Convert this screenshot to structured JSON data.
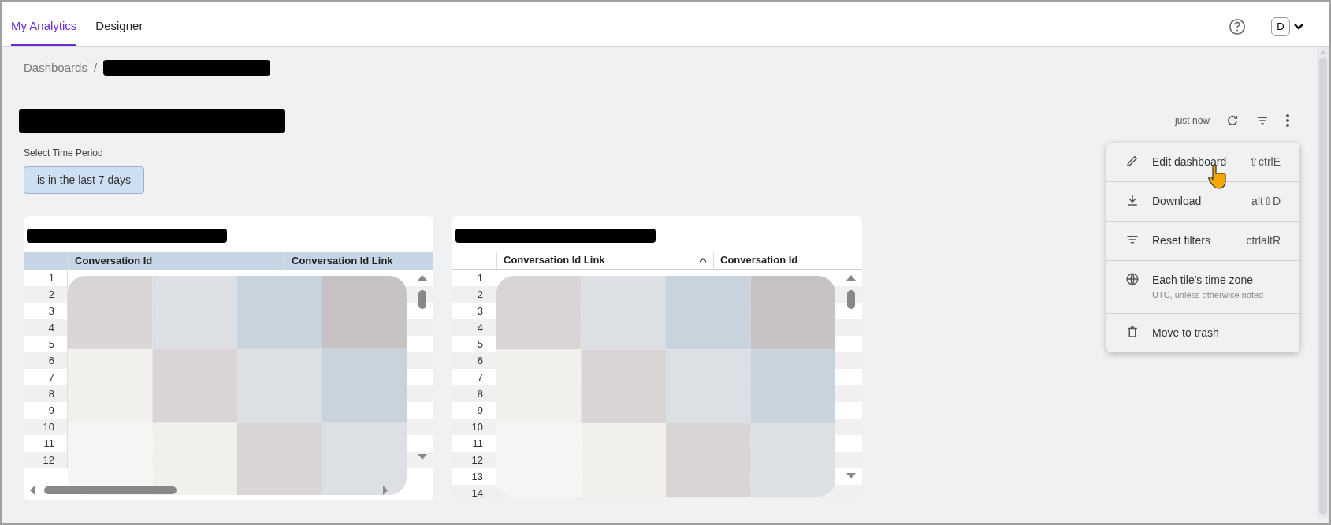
{
  "tabs": [
    {
      "label": "My Analytics",
      "selected": true
    },
    {
      "label": "Designer",
      "selected": false
    }
  ],
  "user": {
    "initial": "D"
  },
  "breadcrumb": {
    "root": "Dashboards",
    "separator": "/"
  },
  "toolbar": {
    "updated": "just now"
  },
  "filter": {
    "label": "Select Time Period",
    "value": "is in the last 7 days"
  },
  "tiles": [
    {
      "kind": "shaded",
      "columns": [
        {
          "label": "Conversation Id",
          "sorted": false
        },
        {
          "label": "Conversation Id Link",
          "sorted": false
        }
      ],
      "rows": [
        "1",
        "2",
        "3",
        "4",
        "5",
        "6",
        "7",
        "8",
        "9",
        "10",
        "11",
        "12"
      ],
      "horizontal_scroll": true
    },
    {
      "kind": "plain",
      "columns": [
        {
          "label": "Conversation Id Link",
          "sorted": true
        },
        {
          "label": "Conversation Id",
          "sorted": false
        }
      ],
      "rows": [
        "1",
        "2",
        "3",
        "4",
        "5",
        "6",
        "7",
        "8",
        "9",
        "10",
        "11",
        "12",
        "13",
        "14"
      ],
      "horizontal_scroll": false
    }
  ],
  "menu": [
    {
      "kind": "edit",
      "label": "Edit dashboard",
      "shortcut": "⇧ctrlE"
    },
    {
      "kind": "download",
      "label": "Download",
      "shortcut": "alt⇧D"
    },
    {
      "kind": "filter",
      "label": "Reset filters",
      "shortcut": "ctrlaltR"
    },
    {
      "kind": "globe",
      "label": "Each tile's time zone",
      "note": "UTC, unless otherwise noted"
    },
    {
      "kind": "trash",
      "label": "Move to trash"
    }
  ]
}
